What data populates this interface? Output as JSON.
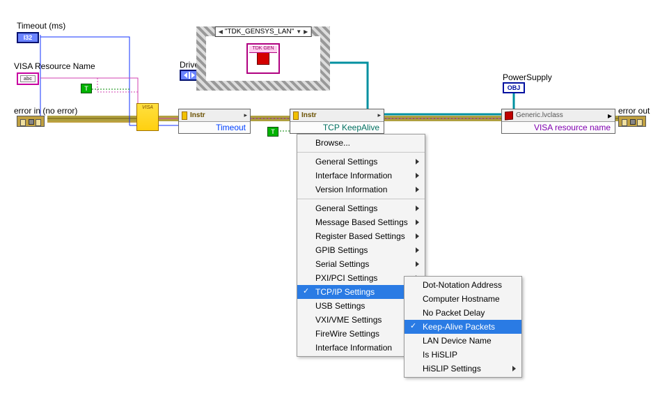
{
  "controls": {
    "timeout_label": "Timeout (ms)",
    "timeout_type": "I32",
    "visa_label": "VISA Resource Name",
    "visa_inner": "abc",
    "driver_label": "Driver",
    "error_in_label": "error in (no error)",
    "bool_true": "T"
  },
  "indicators": {
    "power_label": "PowerSupply",
    "obj_text": "OBJ",
    "error_out_label": "error out"
  },
  "case": {
    "value": "\"TDK_GENSYS_LAN\"",
    "class_tag": "TDK GEN"
  },
  "prop_nodes": {
    "instr1_header": "Instr",
    "instr1_row1": "Timeout",
    "instr2_header": "Instr",
    "instr2_row1": "TCP KeepAlive",
    "class_header": "Generic.lvclass",
    "class_row1": "VISA resource name"
  },
  "menu": {
    "group1": [
      {
        "label": "Browse...",
        "submenu": false
      }
    ],
    "group2": [
      {
        "label": "General Settings",
        "submenu": true
      },
      {
        "label": "Interface Information",
        "submenu": true
      },
      {
        "label": "Version Information",
        "submenu": true
      }
    ],
    "group3": [
      {
        "label": "General Settings",
        "submenu": true
      },
      {
        "label": "Message Based Settings",
        "submenu": true
      },
      {
        "label": "Register Based Settings",
        "submenu": true
      },
      {
        "label": "GPIB Settings",
        "submenu": true
      },
      {
        "label": "Serial Settings",
        "submenu": true
      },
      {
        "label": "PXI/PCI Settings",
        "submenu": true
      },
      {
        "label": "TCP/IP Settings",
        "submenu": true,
        "highlight": true,
        "checked": true
      },
      {
        "label": "USB Settings",
        "submenu": true
      },
      {
        "label": "VXI/VME Settings",
        "submenu": true
      },
      {
        "label": "FireWire Settings",
        "submenu": true
      },
      {
        "label": "Interface Information",
        "submenu": true
      }
    ]
  },
  "submenu": {
    "items": [
      {
        "label": "Dot-Notation Address",
        "submenu": false
      },
      {
        "label": "Computer Hostname",
        "submenu": false
      },
      {
        "label": "No Packet Delay",
        "submenu": false
      },
      {
        "label": "Keep-Alive Packets",
        "submenu": false,
        "highlight": true,
        "checked": true
      },
      {
        "label": "LAN Device Name",
        "submenu": false
      },
      {
        "label": "Is HiSLIP",
        "submenu": false
      },
      {
        "label": "HiSLIP Settings",
        "submenu": true
      }
    ]
  }
}
